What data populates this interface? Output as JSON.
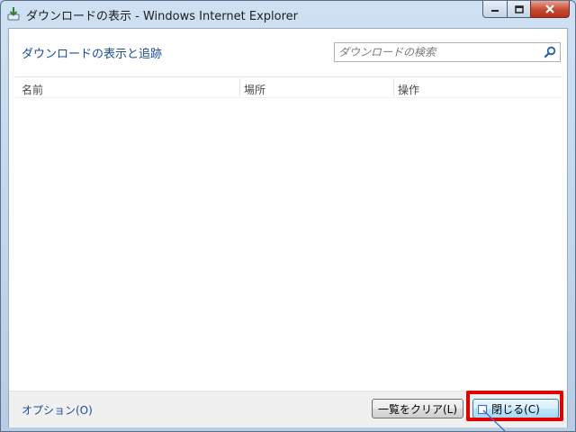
{
  "window": {
    "title": "ダウンロードの表示 - Windows Internet Explorer",
    "controls": {
      "minimize": "minimize",
      "maximize": "maximize",
      "close": "close"
    }
  },
  "header": {
    "heading": "ダウンロードの表示と追跡",
    "search": {
      "placeholder": "ダウンロードの検索",
      "value": ""
    }
  },
  "table": {
    "columns": [
      "名前",
      "場所",
      "操作"
    ],
    "rows": []
  },
  "footer": {
    "options_link": "オプション(O)",
    "clear_button": "一覧をクリア(L)",
    "close_button": "閉じる(C)"
  },
  "colors": {
    "link": "#1a4d9c",
    "highlight": "#e00000",
    "frame": "#b9d1ea"
  },
  "icons": {
    "title": "download-icon",
    "search": "search-icon"
  }
}
